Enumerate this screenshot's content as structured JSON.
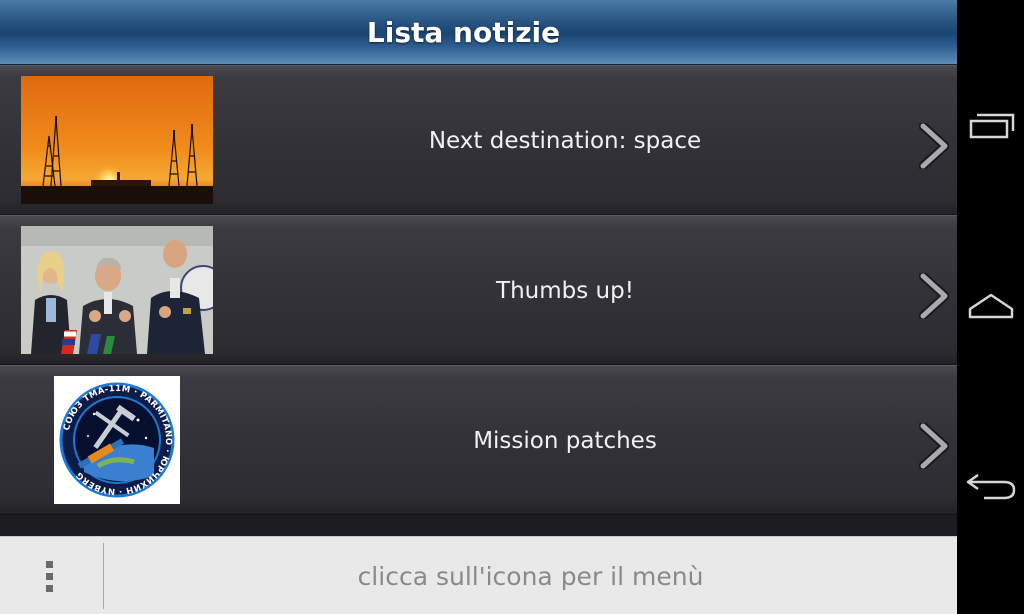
{
  "app": {
    "title": "Lista notizie"
  },
  "news": [
    {
      "title": "Next destination: space",
      "thumbnail": "rocket-launch-sunset-image"
    },
    {
      "title": "Thumbs up!",
      "thumbnail": "crew-thumbs-up-photo"
    },
    {
      "title": "Mission patches",
      "thumbnail": "mission-patch-image"
    }
  ],
  "patch": {
    "ring_text": "СОЮЗ ТМА-11М · PARMITANO · ЮРЧИХИН · NYBERG"
  },
  "bottom_bar": {
    "hint": "clicca sull'icona per il menù",
    "menu_icon": "overflow-menu-icon"
  },
  "system_nav": {
    "icons": [
      "recent-apps-icon",
      "home-icon",
      "back-icon"
    ]
  },
  "colors": {
    "title_bar": "#1b4572",
    "list_bg": "#323238",
    "bottom_bar": "#e9e9e9",
    "hint_text": "#8a8a8a"
  }
}
